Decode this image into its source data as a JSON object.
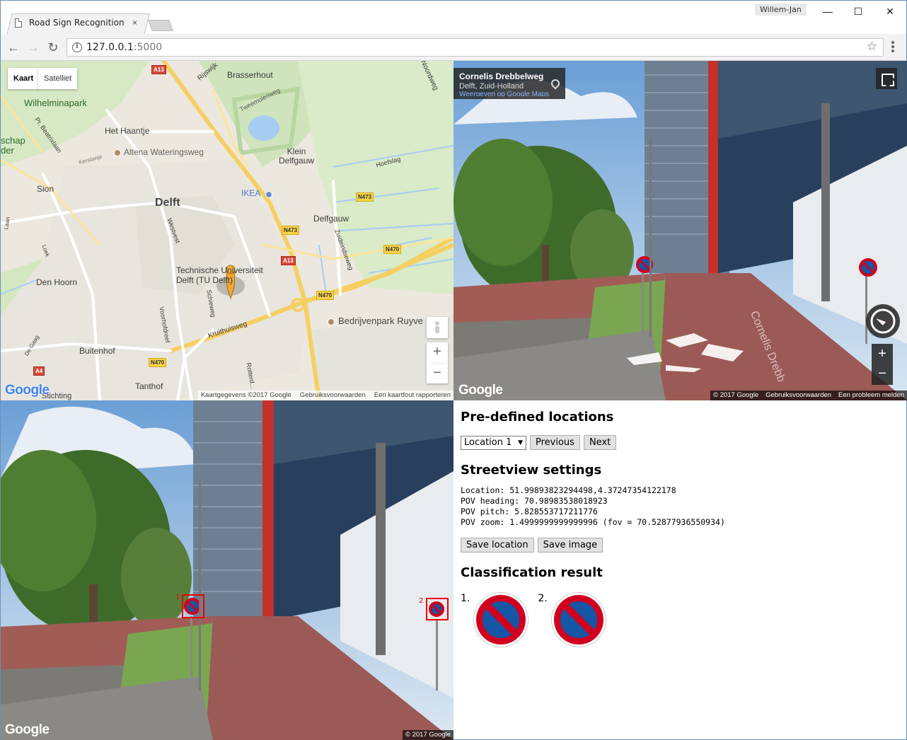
{
  "browser": {
    "tab_title": "Road Sign Recognition",
    "tab_close": "×",
    "user": "Willem-Jan",
    "url_host": "127.0.0.1",
    "url_port": ":5000",
    "window_controls": {
      "minimize": "—",
      "maximize": "☐",
      "close": "✕"
    }
  },
  "map": {
    "type_buttons": [
      "Kaart",
      "Satelliet"
    ],
    "labels": {
      "rijswijk": "Rijswijk",
      "brasserhout": "Brasserhout",
      "noordweg": "Noordweg",
      "tweemolenweg": "Tweemolenweg",
      "wilhelminapark": "Wilhelminapark",
      "schap": "schap",
      "der": "der",
      "pr_beatrixlaan": "Pr. Beatrixlaan",
      "het_haantje": "Het Haantje",
      "altena": "Altena Wateringsweg",
      "kerstanje": "Kerstanje",
      "klein_delfgauw": "Klein\nDelfgauw",
      "hoefslag": "Hoefslag",
      "sion": "Sion",
      "delft": "Delft",
      "ikea": "IKEA",
      "delfgauw": "Delfgauw",
      "westvest": "Westvest",
      "zuideindseweg": "Zuideindseweg",
      "laan": "Laan",
      "loek": "Loek",
      "tu": "Technische Universiteit\nDelft (TU Delft)",
      "den_hoorn": "Den Hoorn",
      "voorhofdreef": "Voorhofdreef",
      "schieweg": "Schieweg",
      "kruithuisweg": "Kruithuisweg",
      "bedrijvenpark": "Bedrijvenpark Ruyve",
      "buitenhof": "Buitenhof",
      "tanthof": "Tanthof",
      "de_gaag": "De Gaag",
      "rotterdamseweg": "Rotterd...",
      "stichting": "Stichting"
    },
    "shields": [
      "A13",
      "N473",
      "N473",
      "N470",
      "A13",
      "N470",
      "N470",
      "A4"
    ],
    "footer": [
      "Kaartgegevens ©2017 Google",
      "Gebruiksvoorwaarden",
      "Een kaartfout rapporteren"
    ],
    "zoom": {
      "in": "+",
      "out": "−"
    },
    "google_logo": "Google"
  },
  "streetview": {
    "title": "Cornelis Drebbelweg",
    "subtitle": "Delft, Zuid-Holland",
    "link": "Weergeven op Google Maps",
    "footer": [
      "© 2017 Google",
      "Gebruiksvoorwaarden",
      "Een probleem melden"
    ],
    "zoom": {
      "in": "+",
      "out": "−"
    },
    "google_logo": "Google",
    "road_text": "Cornelis Drebb"
  },
  "capture": {
    "footer": "© 2017 Google",
    "google_logo": "Google",
    "detections": [
      "1",
      "2"
    ]
  },
  "panel": {
    "predefined_title": "Pre-defined locations",
    "location_selected": "Location 1",
    "prev_label": "Previous",
    "next_label": "Next",
    "settings_title": "Streetview settings",
    "location_line": "Location: 51.99893823294498,4.37247354122178",
    "heading_line": "POV heading: 70.98983538018923",
    "pitch_line": "POV pitch: 5.828553717211776",
    "zoom_line": "POV zoom: 1.4999999999999996 (fov = 70.52877936550934)",
    "save_location_label": "Save location",
    "save_image_label": "Save image",
    "result_title": "Classification result",
    "results": [
      "1.",
      "2."
    ]
  }
}
